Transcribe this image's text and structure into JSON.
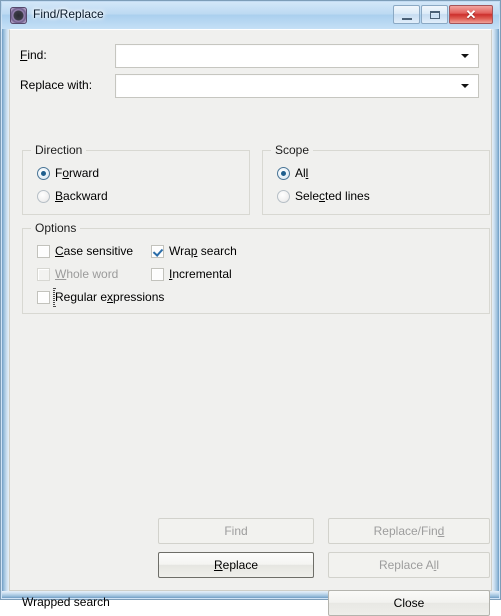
{
  "window": {
    "title": "Find/Replace",
    "icon": "app-icon",
    "controls": {
      "minimize": "minimize",
      "maximize": "restore",
      "close": "✕"
    }
  },
  "fields": {
    "find": {
      "label_before": "F",
      "label_mnemonic": "F",
      "label": "ind:",
      "full_label": "Find:",
      "value": "",
      "placeholder": ""
    },
    "replace": {
      "full_label": "Replace with:",
      "value": "",
      "placeholder": ""
    }
  },
  "direction": {
    "title": "Direction",
    "options": [
      {
        "pre": "F",
        "mn": "o",
        "post": "rward",
        "label": "Forward",
        "checked": true,
        "disabled": false
      },
      {
        "pre": "",
        "mn": "B",
        "post": "ackward",
        "label": "Backward",
        "checked": false,
        "disabled": false
      }
    ]
  },
  "scope": {
    "title": "Scope",
    "options": [
      {
        "pre": "Al",
        "mn": "l",
        "post": "",
        "label": "All",
        "checked": true,
        "disabled": false
      },
      {
        "pre": "Sele",
        "mn": "c",
        "post": "ted lines",
        "label": "Selected lines",
        "checked": false,
        "disabled": false
      }
    ]
  },
  "options": {
    "title": "Options",
    "items": [
      {
        "pre": "",
        "mn": "C",
        "post": "ase sensitive",
        "label": "Case sensitive",
        "checked": false,
        "disabled": false,
        "focused": false
      },
      {
        "pre": "Wra",
        "mn": "p",
        "post": " search",
        "label": "Wrap search",
        "checked": true,
        "disabled": false,
        "focused": false
      },
      {
        "pre": "",
        "mn": "W",
        "post": "hole word",
        "label": "Whole word",
        "checked": false,
        "disabled": true,
        "focused": false
      },
      {
        "pre": "",
        "mn": "I",
        "post": "ncremental",
        "label": "Incremental",
        "checked": false,
        "disabled": false,
        "focused": false
      },
      {
        "pre": "Regular e",
        "mn": "x",
        "post": "pressions",
        "label": "Regular expressions",
        "checked": false,
        "disabled": false,
        "focused": true
      }
    ]
  },
  "buttons": {
    "find": {
      "pre": "",
      "mn": "",
      "post": "Find",
      "label": "Find",
      "disabled": true,
      "default": false
    },
    "replace_find": {
      "pre": "Replace/Fin",
      "mn": "d",
      "post": "",
      "label": "Replace/Find",
      "disabled": true,
      "default": false
    },
    "replace": {
      "pre": "",
      "mn": "R",
      "post": "eplace",
      "label": "Replace",
      "disabled": false,
      "default": true
    },
    "replace_all": {
      "pre": "Replace A",
      "mn": "l",
      "post": "l",
      "label": "Replace All",
      "disabled": true,
      "default": false
    },
    "close": {
      "pre": "",
      "mn": "",
      "post": "Close",
      "label": "Close",
      "disabled": false,
      "default": false
    }
  },
  "status": {
    "message": "Wrapped search"
  },
  "colors": {
    "dialog_bg": "#f0f0ee",
    "titlebar": "#bcd9f2",
    "close_button": "#cc2f2c",
    "check_mark": "#2a6ca8",
    "radio_dot": "#1e5f8e",
    "disabled_text": "#9b9b9b"
  }
}
